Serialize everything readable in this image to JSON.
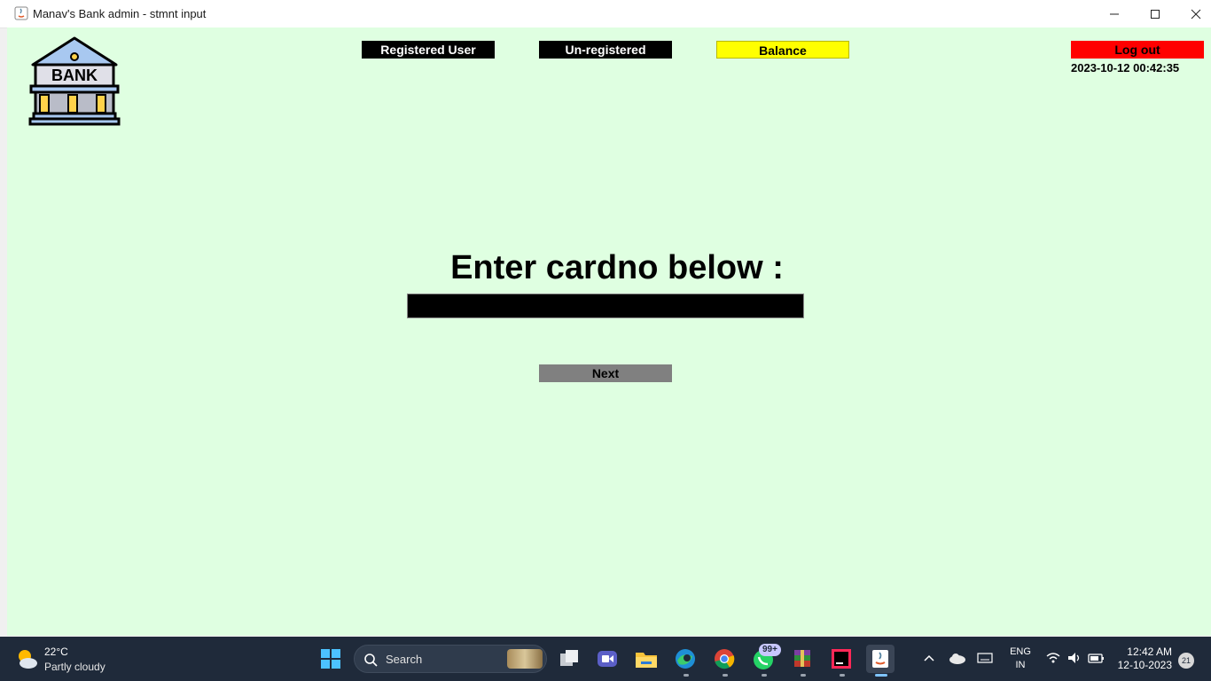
{
  "window": {
    "title": "Manav's Bank admin - stmnt input"
  },
  "logo": {
    "text": "BANK"
  },
  "nav": {
    "registered": "Registered User",
    "unregistered": "Un-registered",
    "balance": "Balance",
    "logout": "Log out"
  },
  "datetime": "2023-10-12 00:42:35",
  "form": {
    "heading": "Enter cardno below :",
    "card_value": "",
    "next_label": "Next"
  },
  "colors": {
    "background": "#dfffe1",
    "balance": "#ffff00",
    "logout": "#ff0000",
    "next": "#808080",
    "nav_dark": "#000000"
  },
  "taskbar": {
    "temperature": "22°C",
    "condition": "Partly cloudy",
    "search_label": "Search",
    "whatsapp_badge": "99+",
    "lang_line1": "ENG",
    "lang_line2": "IN",
    "time": "12:42 AM",
    "date": "12-10-2023",
    "notifications": "21",
    "icons": [
      "start-icon",
      "search-icon",
      "task-view-icon",
      "meet-icon",
      "file-explorer-icon",
      "edge-icon",
      "chrome-icon",
      "whatsapp-icon",
      "winrar-icon",
      "intellij-icon",
      "java-icon",
      "chevron-up-icon",
      "onedrive-icon",
      "keyboard-icon",
      "wifi-icon",
      "volume-icon",
      "battery-icon"
    ]
  }
}
